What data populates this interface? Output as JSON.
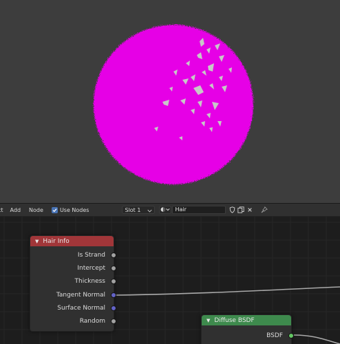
{
  "header": {
    "menu": [
      "ct",
      "Add",
      "Node"
    ],
    "use_nodes_label": "Use Nodes",
    "use_nodes_checked": true,
    "slot_label": "Slot 1",
    "material_name": "Hair"
  },
  "nodes": {
    "hair_info": {
      "title": "Hair Info",
      "outputs": [
        "Is Strand",
        "Intercept",
        "Thickness",
        "Tangent Normal",
        "Surface Normal",
        "Random"
      ],
      "header_color": "#a13639"
    },
    "diffuse_bsdf": {
      "title": "Diffuse BSDF",
      "outputs": [
        "BSDF"
      ],
      "header_color": "#3e8a4d"
    }
  },
  "viewport": {
    "background_color": "#3d3d3d",
    "sphere_color": "#e600e6"
  },
  "socket_colors": {
    "float": "#a1a1a1",
    "vector": "#6363c7",
    "shader": "#63c763"
  }
}
